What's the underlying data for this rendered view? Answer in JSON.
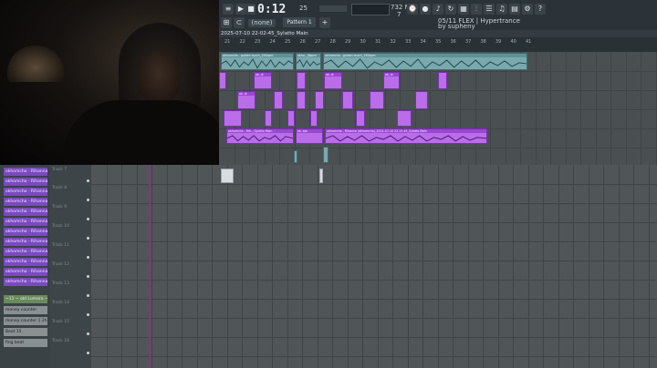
{
  "toolbar": {
    "time": "0:12",
    "time_small": "25",
    "pattern_label": "Pattern 1",
    "mode_label": "(none)",
    "tempo": "732 MB",
    "tempo_sub": "7",
    "news_line1": "05/11  FLEX | Hypertrance",
    "news_line2": "by supheny"
  },
  "playlist": {
    "title": "2025-07-10 22-02-45_Sylatto Main",
    "ruler_ticks": [
      "21",
      "22",
      "23",
      "24",
      "25",
      "26",
      "27",
      "28",
      "29",
      "30",
      "31",
      "32",
      "33",
      "34",
      "35",
      "36",
      "37",
      "38",
      "39",
      "40",
      "41"
    ]
  },
  "clips": [
    {
      "label": "okhomcha - golden touch_150bpm",
      "color": "teal"
    },
    {
      "label": "okho.._Bbpm",
      "color": "teal"
    },
    {
      "label": "okhomcha - golden touch_150bpm",
      "color": "teal"
    },
    {
      "label": "ok..ik",
      "color": "purple"
    },
    {
      "label": "ok..ik",
      "color": "purple"
    },
    {
      "label": "ok..ik",
      "color": "purple"
    },
    {
      "label": "ok..ik",
      "color": "purple"
    },
    {
      "label": "okhomcha - Rih.._Sylatto Main",
      "color": "purple"
    },
    {
      "label": "ok..aia",
      "color": "purple"
    },
    {
      "label": "okhomcha - Rihanna (okhomcha)_2021-07-10 22-13-45_Sylatto Main",
      "color": "purple"
    }
  ],
  "tracks": [
    "Track 7",
    "Track 8",
    "Track 9",
    "Track 10",
    "Track 11",
    "Track 12",
    "Track 13",
    "Track 14",
    "Track 15",
    "Track 16"
  ],
  "patterns": [
    "okhomcha - Rihanna (ok..",
    "okhomcha - Rihanna (ok..",
    "okhomcha - Rihanna (ok..",
    "okhomcha - Rihanna (ok..",
    "okhomcha - Rihanna (ok..",
    "okhomcha - Rihanna (ok..",
    "okhomcha - Rihanna (ok..",
    "okhomcha - Rihanna (ok..",
    "okhomcha - Rihanna (ok..",
    "okhomcha - Rihanna (ok..",
    "okhomcha - Rihanna (ok..",
    "okhomcha - Rihanna (ok.."
  ],
  "extra_patterns": [
    "~11 ~ old Lumara ~ w",
    "money counter",
    "money counter 1 2h",
    "Beat 15",
    "fing beat"
  ],
  "colors": {
    "accent": "#b96de8",
    "teal_clip": "#7aa8ad",
    "playhead": "#7e3a78"
  }
}
